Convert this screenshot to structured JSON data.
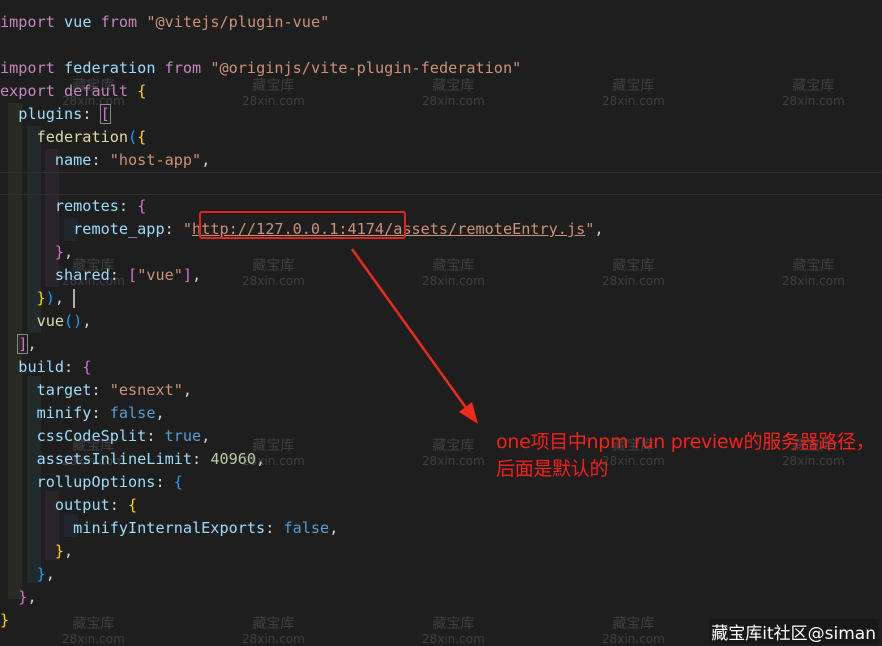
{
  "code": {
    "l1": [
      "import",
      "vue",
      "from",
      "\"@vitejs/plugin-vue\""
    ],
    "l3": [
      "import",
      "federation",
      "from",
      "\"@originjs/vite-plugin-federation\""
    ],
    "l4": [
      "export",
      "default",
      "{"
    ],
    "l5": [
      "plugins",
      ":",
      "["
    ],
    "l6": [
      "federation",
      "(",
      "{"
    ],
    "l7": [
      "name",
      ": ",
      "\"host-app\"",
      ","
    ],
    "l9": [
      "remotes",
      ": ",
      "{"
    ],
    "l10": [
      "remote_app",
      ": ",
      "\"",
      "http://127.0.0.1:4174/",
      "assets/remoteEntry.js",
      "\"",
      ","
    ],
    "l11": [
      "}",
      ","
    ],
    "l12": [
      "shared",
      ": ",
      "[",
      "\"vue\"",
      "]",
      ","
    ],
    "l13": [
      "}",
      ")",
      ","
    ],
    "l14": [
      "vue",
      "(",
      ")",
      ","
    ],
    "l15": [
      "]",
      ","
    ],
    "l16": [
      "build",
      ": ",
      "{"
    ],
    "l17": [
      "target",
      ": ",
      "\"esnext\"",
      ","
    ],
    "l18": [
      "minify",
      ": ",
      "false",
      ","
    ],
    "l19": [
      "cssCodeSplit",
      ": ",
      "true",
      ","
    ],
    "l20": [
      "assetsInlineLimit",
      ": ",
      "40960",
      ","
    ],
    "l21": [
      "rollupOptions",
      ": ",
      "{"
    ],
    "l22": [
      "output",
      ": ",
      "{"
    ],
    "l23": [
      "minifyInternalExports",
      ": ",
      "false",
      ","
    ],
    "l24": [
      "}",
      ","
    ],
    "l25": [
      "}",
      ","
    ],
    "l26": [
      "}",
      ","
    ],
    "l27": [
      "}"
    ]
  },
  "annotation": {
    "text": "one项目中npm run preview的服务器路径，后面是默认的"
  },
  "watermark": {
    "line1": "藏宝库",
    "line2": "28xin.com"
  },
  "corner_mark": "藏宝库it社区@siman",
  "colors": {
    "background": "#1e1e1e",
    "annotation": "#f5201b",
    "highlight_box": "#e0261b"
  }
}
